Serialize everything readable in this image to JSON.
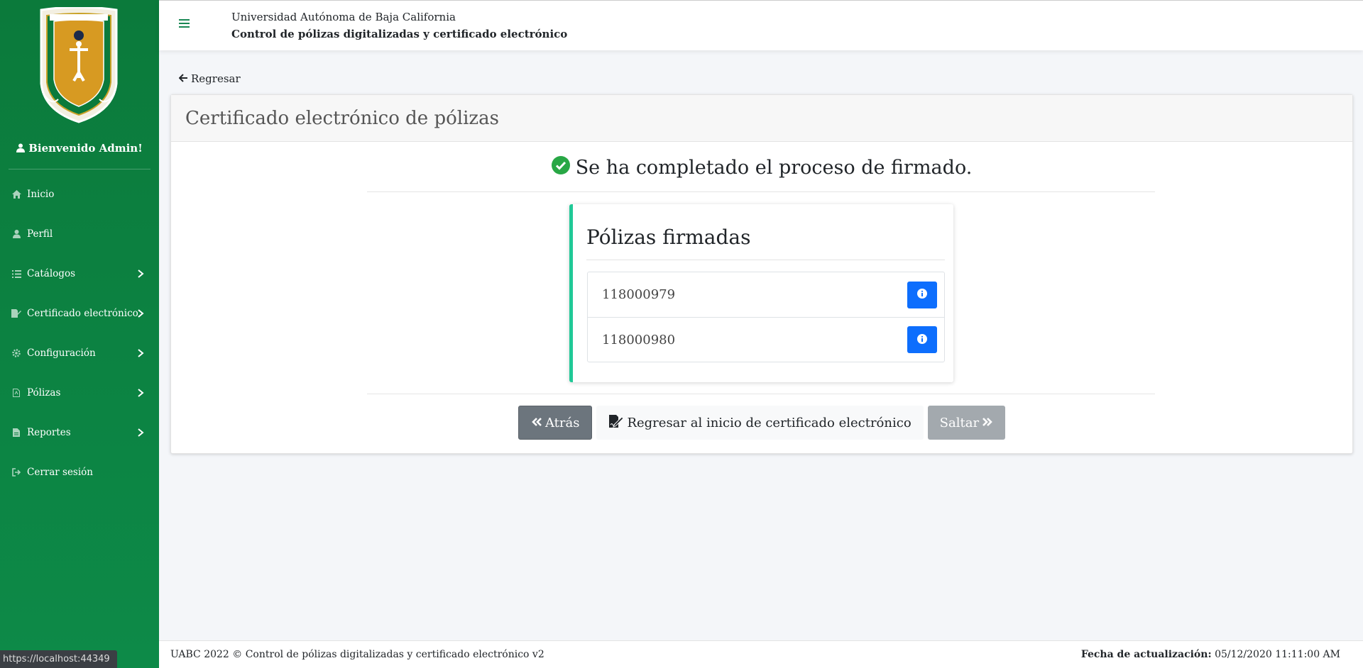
{
  "sidebar": {
    "welcome": "Bienvenido Admin!",
    "items": [
      {
        "label": "Inicio",
        "icon": "home-icon"
      },
      {
        "label": "Perfil",
        "icon": "user-icon"
      },
      {
        "label": "Catálogos",
        "icon": "list-icon"
      },
      {
        "label": "Certificado electrónico",
        "icon": "file-signature-icon"
      },
      {
        "label": "Configuración",
        "icon": "gear-icon"
      },
      {
        "label": "Pólizas",
        "icon": "file-pdf-icon"
      },
      {
        "label": "Reportes",
        "icon": "file-icon"
      },
      {
        "label": "Cerrar sesión",
        "icon": "sign-out-icon"
      }
    ]
  },
  "header": {
    "line1": "Universidad Autónoma de Baja California",
    "line2": "Control de pólizas digitalizadas y certificado electrónico"
  },
  "main": {
    "back_label": "Regresar",
    "card_title": "Certificado electrónico de pólizas",
    "success_message": "Se ha completado el proceso de firmado.",
    "panel_title": "Pólizas firmadas",
    "polizas": [
      "118000979",
      "118000980"
    ],
    "btn_back": "Atrás",
    "btn_home": "Regresar al inicio de certificado electrónico",
    "btn_skip": "Saltar"
  },
  "footer": {
    "left": "UABC 2022 © Control de pólizas digitalizadas y certificado electrónico v2",
    "date_label": "Fecha de actualización:",
    "date_value": "05/12/2020 11:11:00 AM"
  },
  "status_url": "https://localhost:44349",
  "colors": {
    "sidebar": "#0b7a3b",
    "primary": "#0d6efd",
    "success": "#28a745",
    "panel_accent": "#20c997",
    "secondary": "#6c757d"
  }
}
